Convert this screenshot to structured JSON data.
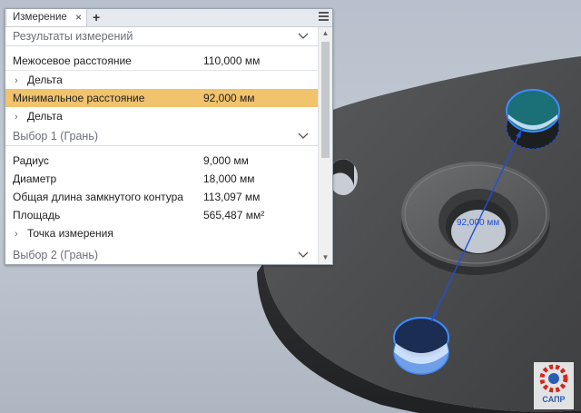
{
  "panel": {
    "tab_label": "Измерение",
    "tab_close": "×",
    "tab_add": "+",
    "sections": {
      "results_title": "Результаты измерений",
      "selection1_title": "Выбор 1 (Грань)",
      "selection2_title": "Выбор 2 (Грань)"
    },
    "results": [
      {
        "label": "Межосевое расстояние",
        "value": "110,000 мм"
      },
      {
        "label": "Дельта"
      },
      {
        "label": "Минимальное расстояние",
        "value": "92,000 мм"
      },
      {
        "label": "Дельта"
      }
    ],
    "selection1": [
      {
        "label": "Радиус",
        "value": "9,000 мм"
      },
      {
        "label": "Диаметр",
        "value": "18,000 мм"
      },
      {
        "label": "Общая длина замкнутого контура",
        "value": "113,097 мм"
      },
      {
        "label": "Площадь",
        "value": "565,487 мм²"
      },
      {
        "label": "Точка измерения"
      }
    ]
  },
  "scene": {
    "dimension_label": "92,000 мм",
    "accent": "#1f4fd8",
    "part_color": "#4a4b4d"
  },
  "logo": {
    "text": "САПР"
  }
}
